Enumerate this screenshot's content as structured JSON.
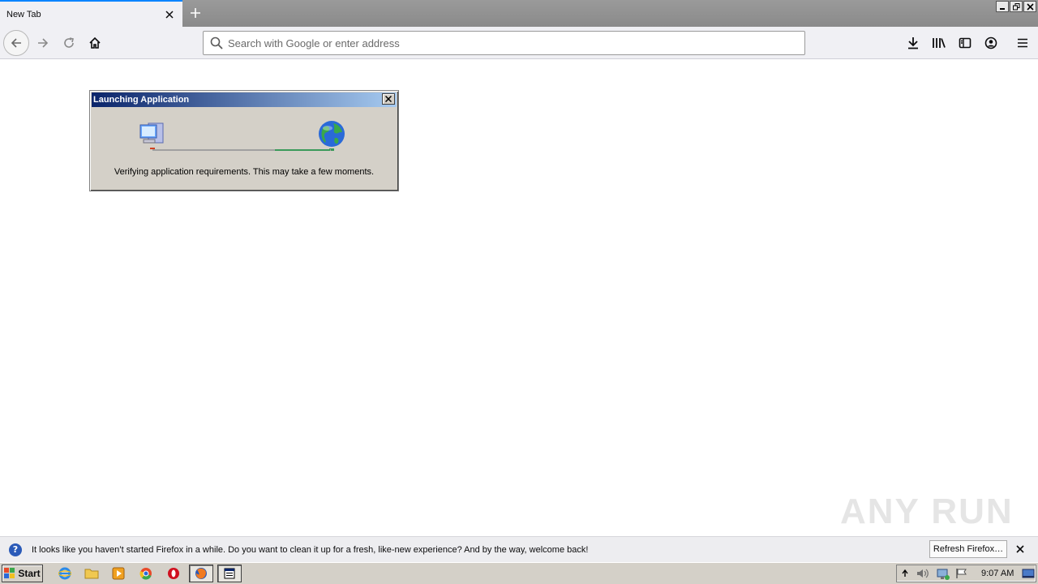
{
  "browser": {
    "tab_title": "New Tab",
    "url_placeholder": "Search with Google or enter address"
  },
  "dialog": {
    "title": "Launching Application",
    "message": "Verifying application requirements. This may take a few moments."
  },
  "notification": {
    "text": "It looks like you haven’t started Firefox in a while. Do you want to clean it up for a fresh, like-new experience? And by the way, welcome back!",
    "button_label": "Refresh Firefox…"
  },
  "watermark": "ANY RUN",
  "taskbar": {
    "start_label": "Start",
    "clock": "9:07 AM"
  },
  "colors": {
    "accent": "#0a84ff",
    "dialog_title_start": "#0a246a",
    "dialog_title_end": "#a6caf0"
  }
}
